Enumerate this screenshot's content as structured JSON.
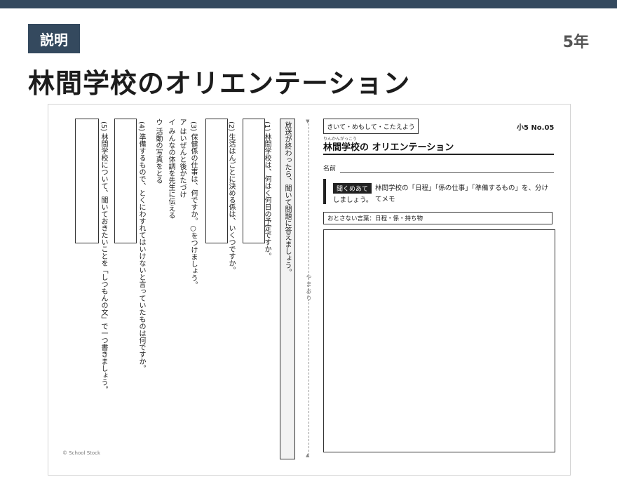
{
  "header": {
    "badge": "説明",
    "grade": "5年",
    "title": "林間学校のオリエンテーション"
  },
  "worksheet": {
    "instruction": "放送が終わったら、聞いて問題に答えましょう。",
    "q1": "(1) 林間学校は、何はく何日の予定ですか。",
    "q2": "(2) 生活はんごとに決める係は、いくつですか。",
    "q3": "(3) 保健係の仕事は、何ですか。○をつけましょう。",
    "q3_a": "ア はいぜんと後かたづけ",
    "q3_i": "イ みんなの体調を先生に伝える",
    "q3_u": "ウ 活動の写真をとる",
    "q4": "(4) 準備するもので、とくにわすれてはいけないと言っていたものは何ですか。",
    "q5": "(5) 林間学校について、聞いておきたいことを「しつもんの文」で一つ書きましょう。",
    "fold_label": "やまおり",
    "tag": "きいて・めもして・こたえよう",
    "grade_no": "小5 No.05",
    "ruby": "りんかんがっこう",
    "sheet_title": "林間学校の オリエンテーション",
    "name_label": "名前",
    "listen_badge": "聞くめあて",
    "listen_text": "林間学校の「日程」「係の仕事」「準備するもの」を、分けてメモ",
    "listen_text2": "しましょう。",
    "words": "おとさない言葉：日程・係・持ち物",
    "copyright": "© School Stock"
  }
}
